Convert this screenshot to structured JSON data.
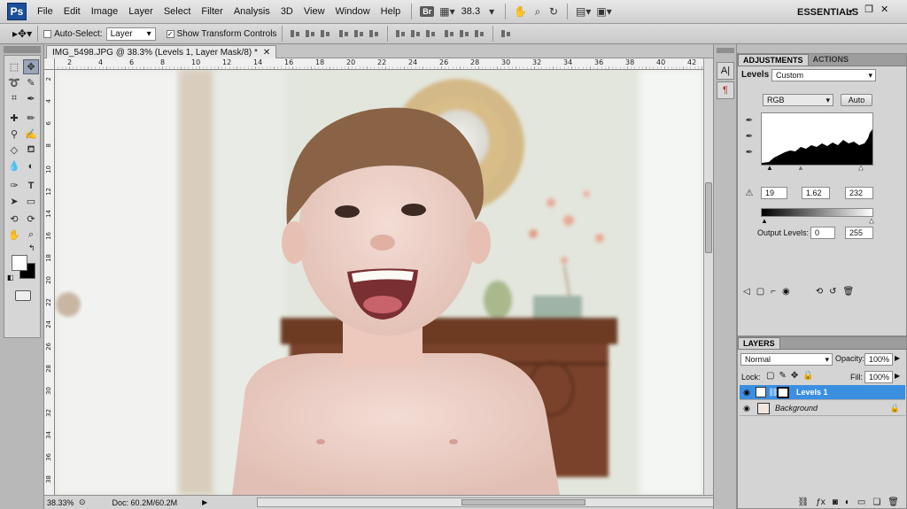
{
  "app": {
    "logo": "Ps",
    "workspace": "ESSENTIALS"
  },
  "menu": [
    "File",
    "Edit",
    "Image",
    "Layer",
    "Select",
    "Filter",
    "Analysis",
    "3D",
    "View",
    "Window",
    "Help"
  ],
  "menubar_tools": {
    "bridge": "Br",
    "zoom": "38.3"
  },
  "options": {
    "auto_select_label": "Auto-Select:",
    "auto_select_value": "Layer",
    "show_transform_label": "Show Transform Controls"
  },
  "document": {
    "tab_title": "IMG_5498.JPG @ 38.3% (Levels 1, Layer Mask/8) *",
    "zoom_status": "38.33%",
    "doc_size": "Doc: 60.2M/60.2M",
    "ruler_top": [
      "2",
      "4",
      "6",
      "8",
      "10",
      "12",
      "14",
      "16",
      "18",
      "20",
      "22",
      "24",
      "26",
      "28",
      "30",
      "32",
      "34",
      "36",
      "38",
      "40",
      "42"
    ],
    "ruler_left": [
      "2",
      "4",
      "6",
      "8",
      "10",
      "12",
      "14",
      "16",
      "18",
      "20",
      "22",
      "24",
      "26",
      "28",
      "30",
      "32",
      "34",
      "36",
      "38"
    ]
  },
  "adjustments": {
    "tabs": [
      "ADJUSTMENTS",
      "ACTIONS"
    ],
    "title": "Levels",
    "preset": "Custom",
    "channel": "RGB",
    "auto_label": "Auto",
    "input_black": "19",
    "input_gamma": "1.62",
    "input_white": "232",
    "output_label": "Output Levels:",
    "output_black": "0",
    "output_white": "255"
  },
  "layers": {
    "tab": "LAYERS",
    "blend_mode": "Normal",
    "opacity_label": "Opacity:",
    "opacity": "100%",
    "lock_label": "Lock:",
    "fill_label": "Fill:",
    "fill": "100%",
    "items": [
      {
        "name": "Levels 1",
        "selected": true
      },
      {
        "name": "Background",
        "selected": false
      }
    ]
  },
  "colors": {
    "accent_selection": "#3b8fe0",
    "panel_bg": "#d4d4d4",
    "ps_blue": "#1b4f9a"
  }
}
